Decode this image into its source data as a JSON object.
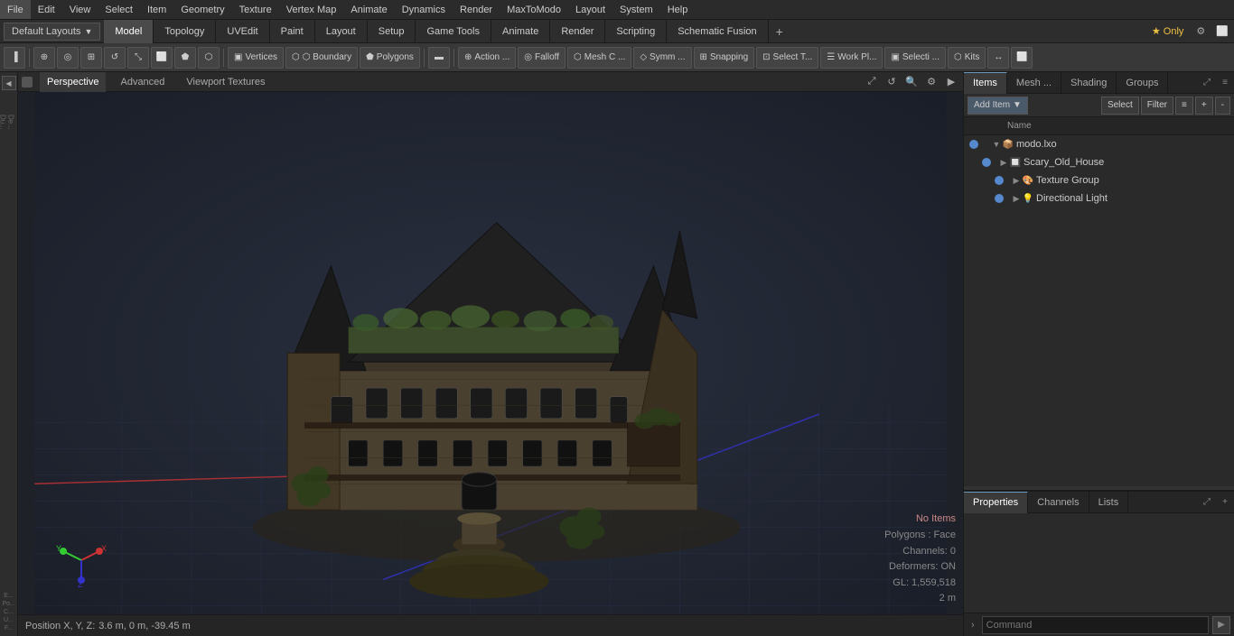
{
  "menu": {
    "items": [
      "File",
      "Edit",
      "View",
      "Select",
      "Item",
      "Geometry",
      "Texture",
      "Vertex Map",
      "Animate",
      "Dynamics",
      "Render",
      "MaxToModo",
      "Layout",
      "System",
      "Help"
    ]
  },
  "layout_bar": {
    "dropdown_label": "Default Layouts",
    "tabs": [
      {
        "label": "Model",
        "active": true
      },
      {
        "label": "Topology",
        "active": false
      },
      {
        "label": "UVEdit",
        "active": false
      },
      {
        "label": "Paint",
        "active": false
      },
      {
        "label": "Layout",
        "active": false
      },
      {
        "label": "Setup",
        "active": false
      },
      {
        "label": "Game Tools",
        "active": false
      },
      {
        "label": "Animate",
        "active": false
      },
      {
        "label": "Render",
        "active": false
      },
      {
        "label": "Scripting",
        "active": false
      },
      {
        "label": "Schematic Fusion",
        "active": false
      }
    ],
    "star_label": "★ Only",
    "plus_label": "+"
  },
  "toolbar": {
    "buttons": [
      {
        "label": "⬡",
        "name": "mesh-icon"
      },
      {
        "label": "⊕",
        "name": "work-plane"
      },
      {
        "label": "◎",
        "name": "transform"
      },
      {
        "label": "↕",
        "name": "move"
      },
      {
        "label": "⬜",
        "name": "select-rect"
      },
      {
        "label": "●",
        "name": "lasso"
      },
      {
        "label": "⬟",
        "name": "poly"
      },
      {
        "label": "⬢",
        "name": "hex-btn"
      }
    ],
    "sep_after": [
      0,
      4
    ],
    "mode_buttons": [
      {
        "label": "▣ Vertices",
        "active": false
      },
      {
        "label": "⬡ Boundary",
        "active": false
      },
      {
        "label": "⬟ Polygons",
        "active": false
      }
    ],
    "tool_buttons": [
      {
        "label": "⊕ Action ...",
        "active": false
      },
      {
        "label": "◎ Falloff",
        "active": false
      },
      {
        "label": "⬡ Mesh C ...",
        "active": false
      },
      {
        "label": "◇ Symm ...",
        "active": false
      },
      {
        "label": "⊞ Snapping",
        "active": false
      },
      {
        "label": "⊡ Select T...",
        "active": false
      },
      {
        "label": "☰ Work Pl...",
        "active": false
      },
      {
        "label": "▣ Selecti ...",
        "active": false
      },
      {
        "label": "⬡ Kits",
        "active": false
      }
    ]
  },
  "viewport": {
    "tabs": [
      "Perspective",
      "Advanced",
      "Viewport Textures"
    ],
    "active_tab": "Perspective",
    "info": {
      "no_items": "No Items",
      "polygons": "Polygons : Face",
      "channels": "Channels: 0",
      "deformers": "Deformers: ON",
      "gl": "GL: 1,559,518",
      "units": "2 m"
    }
  },
  "status_bar": {
    "position": "Position X, Y, Z:",
    "coords": "3.6 m, 0 m, -39.45 m"
  },
  "right_panel": {
    "top_tabs": [
      "Items",
      "Mesh ...",
      "Shading",
      "Groups"
    ],
    "active_top_tab": "Items",
    "toolbar": {
      "add_item": "Add Item",
      "select": "Select",
      "filter": "Filter"
    },
    "col_name": "Name",
    "scene_tree": [
      {
        "id": "modo-lxo",
        "label": "modo.lxo",
        "icon": "📦",
        "level": 0,
        "expanded": true,
        "vis": true
      },
      {
        "id": "scary-old-house",
        "label": "Scary_Old_House",
        "icon": "🔲",
        "level": 1,
        "expanded": false,
        "vis": true
      },
      {
        "id": "texture-group",
        "label": "Texture Group",
        "icon": "🎨",
        "level": 2,
        "expanded": false,
        "vis": true
      },
      {
        "id": "directional-light",
        "label": "Directional Light",
        "icon": "💡",
        "level": 2,
        "expanded": false,
        "vis": true
      }
    ],
    "bottom_tabs": [
      "Properties",
      "Channels",
      "Lists"
    ],
    "active_bottom_tab": "Properties",
    "command_placeholder": "Command"
  }
}
